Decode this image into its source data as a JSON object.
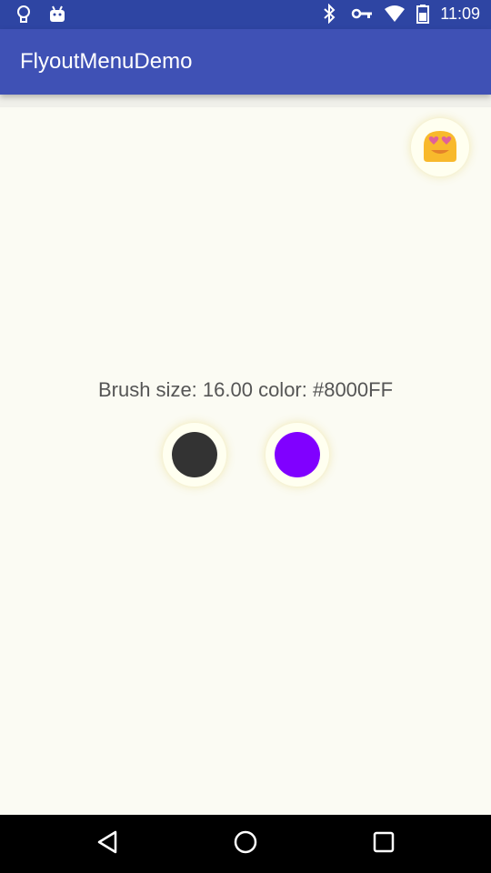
{
  "status_bar": {
    "time": "11:09",
    "left_icons": [
      "lightbulb-icon",
      "android-icon"
    ],
    "right_icons": [
      "bluetooth-icon",
      "vpn-key-icon",
      "wifi-icon",
      "battery-icon"
    ]
  },
  "app_bar": {
    "title": "FlyoutMenuDemo",
    "color": "#3f51b5"
  },
  "content": {
    "emoji_button": {
      "icon": "heart-eyes-emoji-icon"
    },
    "brush_info": "Brush size: 16.00 color: #8000FF",
    "swatches": [
      {
        "name": "dark",
        "color": "#333333"
      },
      {
        "name": "purple",
        "color": "#8000FF"
      }
    ]
  },
  "nav_bar": {
    "buttons": [
      "back-icon",
      "home-icon",
      "recents-icon"
    ]
  }
}
